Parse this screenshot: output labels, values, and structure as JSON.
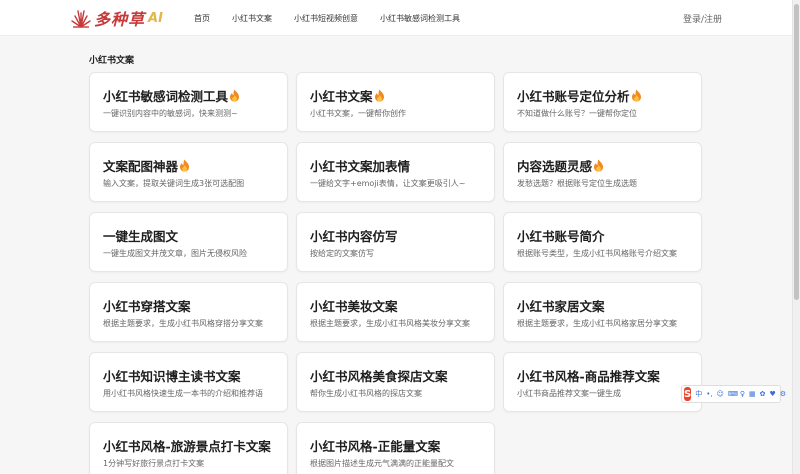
{
  "header": {
    "logo_text": "多种草",
    "logo_ai": "AI",
    "nav": [
      "首页",
      "小红书文案",
      "小红书短视频创意",
      "小红书敏感词检测工具"
    ],
    "login": "登录/注册"
  },
  "section_title": "小红书文案",
  "cards": [
    {
      "title": "小红书敏感词检测工具",
      "desc": "一键识别内容中的敏感词，快来测测~",
      "hot": true
    },
    {
      "title": "小红书文案",
      "desc": "小红书文案，一键帮你创作",
      "hot": true
    },
    {
      "title": "小红书账号定位分析",
      "desc": "不知道做什么账号？一键帮你定位",
      "hot": true
    },
    {
      "title": "文案配图神器",
      "desc": "输入文案，提取关键词生成3张可选配图",
      "hot": true
    },
    {
      "title": "小红书文案加表情",
      "desc": "一键给文字+emoji表情，让文案更吸引人~",
      "hot": false
    },
    {
      "title": "内容选题灵感",
      "desc": "发愁选题？根据账号定位生成选题",
      "hot": true
    },
    {
      "title": "一键生成图文",
      "desc": "一键生成图文并茂文章，图片无侵权风险",
      "hot": false
    },
    {
      "title": "小红书内容仿写",
      "desc": "按给定的文案仿写",
      "hot": false
    },
    {
      "title": "小红书账号简介",
      "desc": "根据账号类型，生成小红书风格账号介绍文案",
      "hot": false
    },
    {
      "title": "小红书穿搭文案",
      "desc": "根据主题要求，生成小红书风格穿搭分享文案",
      "hot": false
    },
    {
      "title": "小红书美妆文案",
      "desc": "根据主题要求，生成小红书风格美妆分享文案",
      "hot": false
    },
    {
      "title": "小红书家居文案",
      "desc": "根据主题要求，生成小红书风格家居分享文案",
      "hot": false
    },
    {
      "title": "小红书知识博主读书文案",
      "desc": "用小红书风格快速生成一本书的介绍和推荐语",
      "hot": false
    },
    {
      "title": "小红书风格美食探店文案",
      "desc": "帮你生成小红书风格的探店文案",
      "hot": false
    },
    {
      "title": "小红书风格-商品推荐文案",
      "desc": "小红书商品推荐文案一键生成",
      "hot": false
    },
    {
      "title": "小红书风格-旅游景点打卡文案",
      "desc": "1分钟写好旅行景点打卡文案",
      "hot": false
    },
    {
      "title": "小红书风格-正能量文案",
      "desc": "根据图片描述生成元气满满的正能量配文",
      "hot": false
    }
  ],
  "ime": {
    "logo": "S",
    "items": [
      "中",
      "•,",
      "☺",
      "⌨",
      "♀",
      "▦",
      "✿",
      "♥",
      "⚙"
    ]
  },
  "colors": {
    "logo_red": "#c73a3a",
    "logo_gold": "#e3b64a",
    "fire_orange": "#f08a24",
    "ime_red": "#e8452c"
  }
}
